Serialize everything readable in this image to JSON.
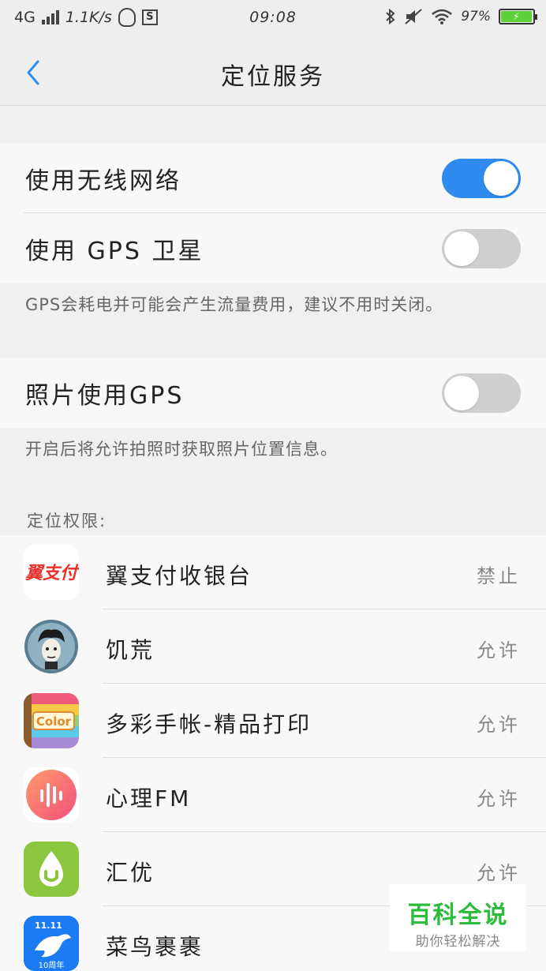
{
  "status_bar": {
    "network": "4G",
    "speed": "1.1K/s",
    "time": "09:08",
    "battery": "97%",
    "icons": [
      "signal-icon",
      "qq-icon",
      "s-icon",
      "bluetooth-icon",
      "mute-icon",
      "wifi-icon",
      "battery-icon"
    ]
  },
  "header": {
    "title": "定位服务",
    "back_icon": "chevron-left-icon",
    "accent_color": "#2f8bf0"
  },
  "settings": {
    "wireless": {
      "label": "使用无线网络",
      "enabled": true
    },
    "gps": {
      "label": "使用 GPS 卫星",
      "enabled": false
    },
    "gps_hint": "GPS会耗电并可能会产生流量费用，建议不用时关闭。",
    "photo_gps": {
      "label": "照片使用GPS",
      "enabled": false
    },
    "photo_hint": "开启后将允许拍照时获取照片位置信息。"
  },
  "permissions": {
    "title": "定位权限:",
    "apps": [
      {
        "name": "翼支付收银台",
        "status": "禁止",
        "icon": "bestpay-icon"
      },
      {
        "name": "饥荒",
        "status": "允许",
        "icon": "dont-starve-icon"
      },
      {
        "name": "多彩手帐-精品打印",
        "status": "允许",
        "icon": "color-notebook-icon"
      },
      {
        "name": "心理FM",
        "status": "允许",
        "icon": "xinli-fm-icon"
      },
      {
        "name": "汇优",
        "status": "允许",
        "icon": "huiyou-icon"
      },
      {
        "name": "菜鸟裹裹",
        "status": "",
        "icon": "cainiao-icon"
      }
    ]
  },
  "watermark": {
    "main": "百科全说",
    "sub": "助你轻松解决"
  }
}
